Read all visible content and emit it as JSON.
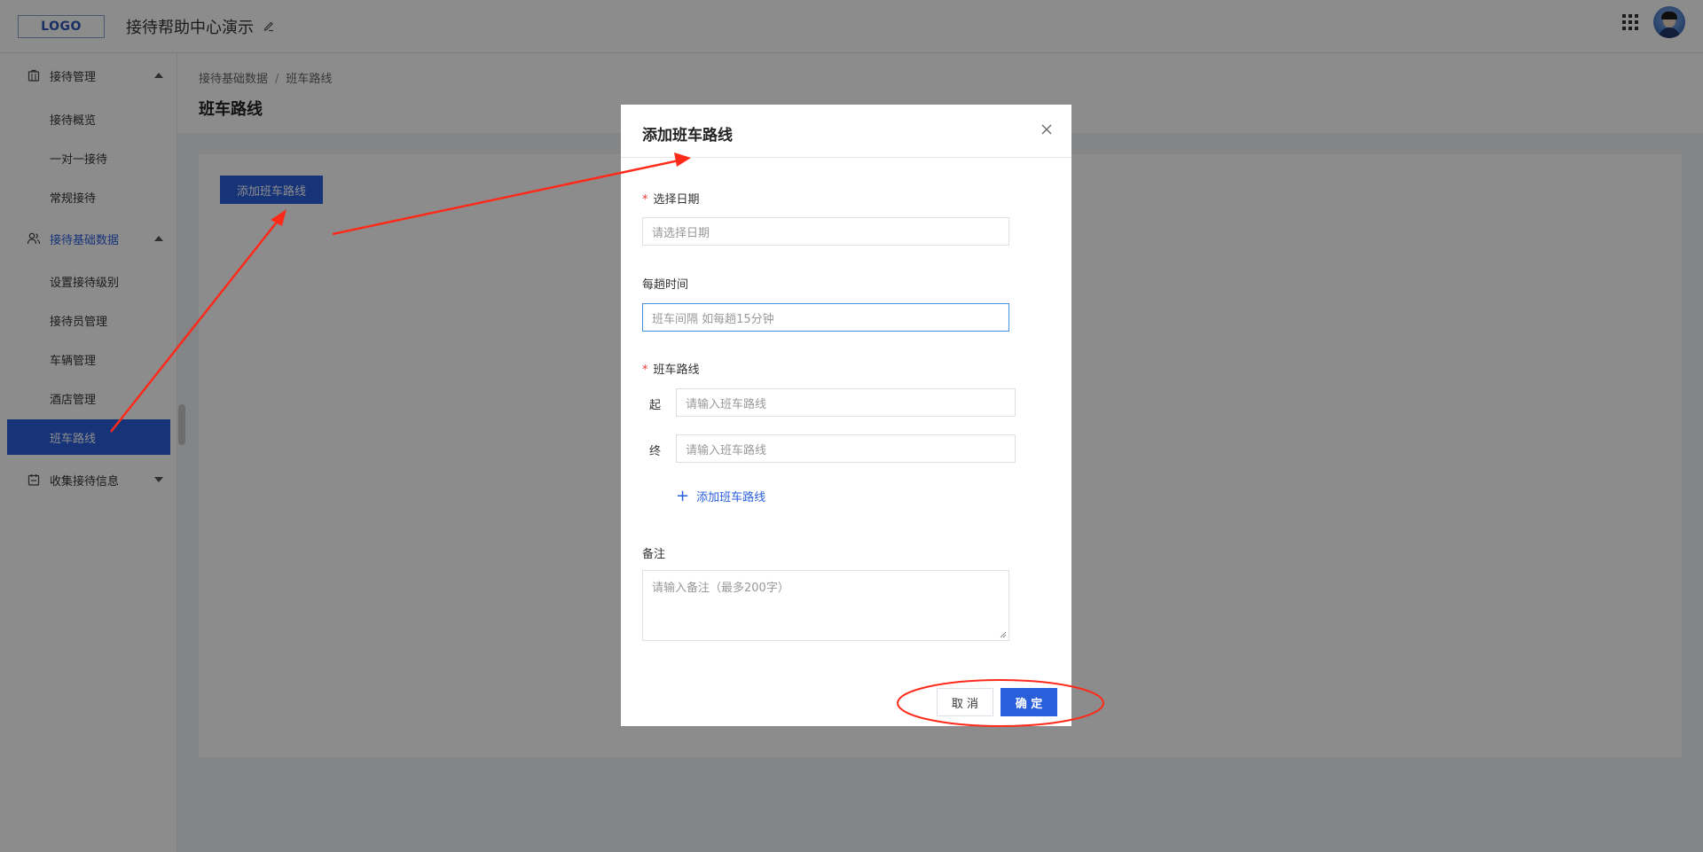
{
  "header": {
    "logo": "LOGO",
    "app_title": "接待帮助中心演示"
  },
  "sidebar": {
    "groups": [
      {
        "label": "接待管理",
        "icon": "briefcase-icon",
        "expanded": true
      },
      {
        "label": "接待基础数据",
        "icon": "users-icon",
        "expanded": true
      },
      {
        "label": "收集接待信息",
        "icon": "calendar-icon",
        "expanded": false
      }
    ],
    "items": [
      {
        "label": "接待概览"
      },
      {
        "label": "一对一接待"
      },
      {
        "label": "常规接待"
      },
      {
        "label": "设置接待级别"
      },
      {
        "label": "接待员管理"
      },
      {
        "label": "车辆管理"
      },
      {
        "label": "酒店管理"
      },
      {
        "label": "班车路线",
        "active": true
      }
    ]
  },
  "breadcrumb": {
    "parent": "接待基础数据",
    "separator": "/",
    "current": "班车路线"
  },
  "page": {
    "title": "班车路线",
    "add_button": "添加班车路线"
  },
  "modal": {
    "title": "添加班车路线",
    "date_label": "选择日期",
    "date_placeholder": "请选择日期",
    "interval_label": "每趟时间",
    "interval_placeholder": "班车间隔 如每趟15分钟",
    "route_label": "班车路线",
    "start_label": "起",
    "start_placeholder": "请输入班车路线",
    "end_label": "终",
    "end_placeholder": "请输入班车路线",
    "add_route": "添加班车路线",
    "remark_label": "备注",
    "remark_placeholder": "请输入备注（最多200字）",
    "required_mark": "*",
    "cancel": "取 消",
    "confirm": "确 定"
  },
  "colors": {
    "primary": "#2a5fdc",
    "required": "#e53935",
    "annotation": "#ff2a1a"
  }
}
